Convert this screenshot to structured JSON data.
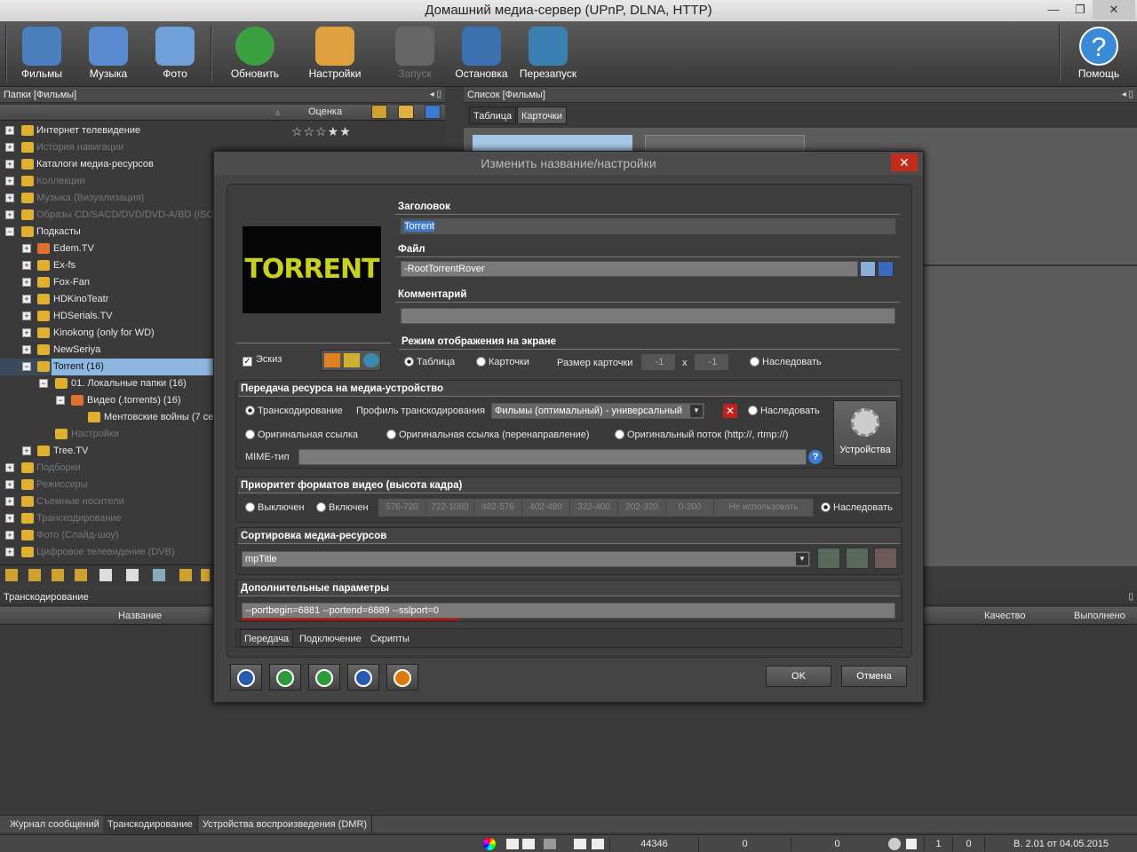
{
  "window": {
    "title": "Домашний медиа-сервер (UPnP, DLNA, HTTP)",
    "min": "—",
    "max": "❐",
    "close": "✕"
  },
  "toolbar": {
    "films": "Фильмы",
    "music": "Музыка",
    "photo": "Фото",
    "refresh": "Обновить",
    "settings": "Настройки",
    "start": "Запуск",
    "stop": "Остановка",
    "restart": "Перезапуск",
    "help": "Помощь"
  },
  "left_panel": {
    "title": "Папки [Фильмы]",
    "col_rating": "Оценка"
  },
  "tree": [
    {
      "label": "Интернет телевидение",
      "dim": false
    },
    {
      "label": "История навигации",
      "dim": true
    },
    {
      "label": "Каталоги медиа-ресурсов",
      "dim": false
    },
    {
      "label": "Коллекции",
      "dim": true
    },
    {
      "label": "Музыка (Визуализация)",
      "dim": true
    },
    {
      "label": "Образы CD/SACD/DVD/DVD-A/BD (ISO)",
      "dim": true
    },
    {
      "label": "Подкасты",
      "dim": false
    },
    {
      "label": "Edem.TV",
      "dim": false
    },
    {
      "label": "Ex-fs",
      "dim": false
    },
    {
      "label": "Fox-Fan",
      "dim": false
    },
    {
      "label": "HDKinoTeatr",
      "dim": false
    },
    {
      "label": "HDSerials.TV",
      "dim": false
    },
    {
      "label": "Kinokong (only for WD)",
      "dim": false
    },
    {
      "label": "NewSeriya",
      "dim": false
    },
    {
      "label": "Torrent (16)",
      "dim": false
    },
    {
      "label": "01. Локальные папки (16)",
      "dim": false
    },
    {
      "label": "Видео (.torrents) (16)",
      "dim": false
    },
    {
      "label": "Ментовские войны (7 се",
      "dim": false
    },
    {
      "label": "Настройки",
      "dim": true
    },
    {
      "label": "Tree.TV",
      "dim": false
    },
    {
      "label": "Подборки",
      "dim": true
    },
    {
      "label": "Режиссеры",
      "dim": true
    },
    {
      "label": "Съемные носители",
      "dim": true
    },
    {
      "label": "Транскодирование",
      "dim": true
    },
    {
      "label": "Фото (Слайд-шоу)",
      "dim": true
    },
    {
      "label": "Цифровое телевидение (DVB)",
      "dim": true
    }
  ],
  "stars": "☆☆☆★★",
  "right_panel": {
    "title": "Список [Фильмы]",
    "tab_table": "Таблица",
    "tab_cards": "Карточки"
  },
  "bottom_panel": {
    "title": "Транскодирование",
    "col_name": "Название",
    "col_quality": "Качество",
    "col_done": "Выполнено"
  },
  "bottom_tabs": [
    "Журнал сообщений",
    "Транскодирование",
    "Устройства воспроизведения (DMR)"
  ],
  "status": {
    "count": "44346",
    "v1": "0",
    "v2": "0",
    "v3": "1",
    "v4": "0",
    "version": "В. 2.01 от 04.05.2015"
  },
  "dialog": {
    "title": "Изменить название/настройки",
    "close": "✕",
    "logo_text": "TORRENT",
    "label_title": "Заголовок",
    "title_value": "Torrent",
    "label_file": "Файл",
    "file_value": "-RootTorrentRover",
    "label_comment": "Комментарий",
    "comment_value": "",
    "thumb_label": "Эскиз",
    "display_mode": "Режим отображения на экране",
    "mode_table": "Таблица",
    "mode_cards": "Карточки",
    "card_size": "Размер карточки",
    "card_w": "-1",
    "card_x": "x",
    "card_h": "-1",
    "inherit": "Наследовать",
    "transfer": "Передача ресурса на медиа-устройство",
    "transcoding": "Транскодирование",
    "profile_label": "Профиль транскодирования",
    "profile_value": "Фильмы (оптимальный) - универсальный",
    "orig_link": "Оригинальная ссылка",
    "orig_link_redirect": "Оригинальная ссылка (перенаправление)",
    "orig_stream": "Оригинальный поток  (http://, rtmp://)",
    "mime": "MIME-тип",
    "mime_value": "",
    "devices": "Устройства",
    "priority": "Приоритет форматов видео (высота кадра)",
    "off": "Выключен",
    "on": "Включен",
    "formats": [
      "576-720",
      "722-1080",
      "482-576",
      "402-480",
      "322-400",
      "202-320",
      "0-200",
      "Не использовать"
    ],
    "sorting": "Сортировка медиа-ресурсов",
    "sort_value": "mpTitle",
    "extra": "Дополнительные параметры",
    "extra_value": "--portbegin=6881 --portend=6889 --sslport=0",
    "tabs": [
      "Передача",
      "Подключение",
      "Скрипты"
    ],
    "ok": "OK",
    "cancel": "Отмена"
  }
}
